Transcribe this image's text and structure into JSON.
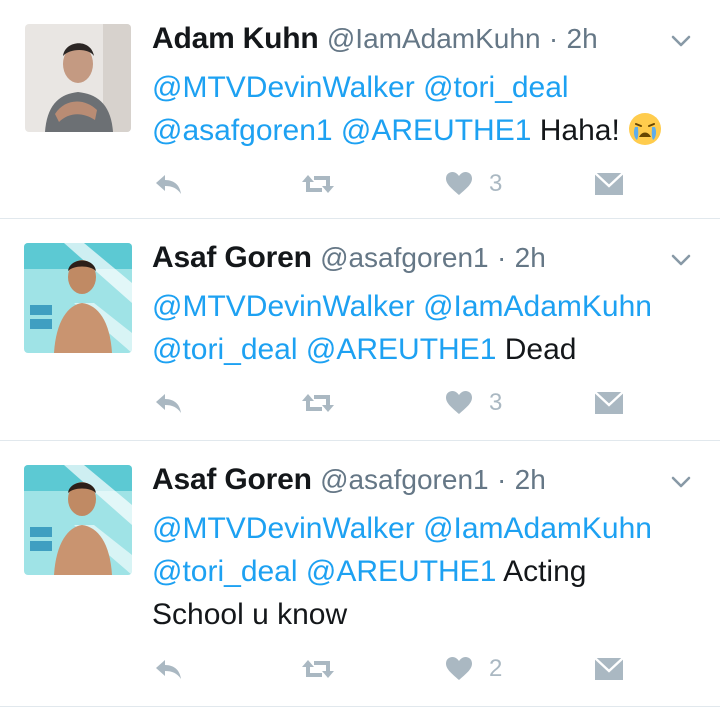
{
  "tweets": [
    {
      "name": "Adam Kuhn",
      "handle": "@IamAdamKuhn",
      "sep": "·",
      "time": "2h",
      "mentions": [
        "@MTVDevinWalker",
        "@tori_deal",
        "@asafgoren1",
        "@AREUTHE1"
      ],
      "text": "Haha!",
      "emoji": "😭",
      "likes": "3"
    },
    {
      "name": "Asaf Goren",
      "handle": "@asafgoren1",
      "sep": "·",
      "time": "2h",
      "mentions": [
        "@MTVDevinWalker",
        "@IamAdamKuhn",
        "@tori_deal",
        "@AREUTHE1"
      ],
      "text": "Dead",
      "likes": "3"
    },
    {
      "name": "Asaf Goren",
      "handle": "@asafgoren1",
      "sep": "·",
      "time": "2h",
      "mentions": [
        "@MTVDevinWalker",
        "@IamAdamKuhn",
        "@tori_deal",
        "@AREUTHE1"
      ],
      "text_part1": "Acting",
      "text_part2": "School u know",
      "likes": "2"
    }
  ],
  "colors": {
    "mention": "#1da1f2",
    "secondary": "#657786",
    "action_icon": "#aab8c2",
    "divider": "#e1e8ed"
  },
  "icons": [
    "chevron-down-icon",
    "reply-icon",
    "retweet-icon",
    "heart-icon",
    "direct-message-icon"
  ]
}
